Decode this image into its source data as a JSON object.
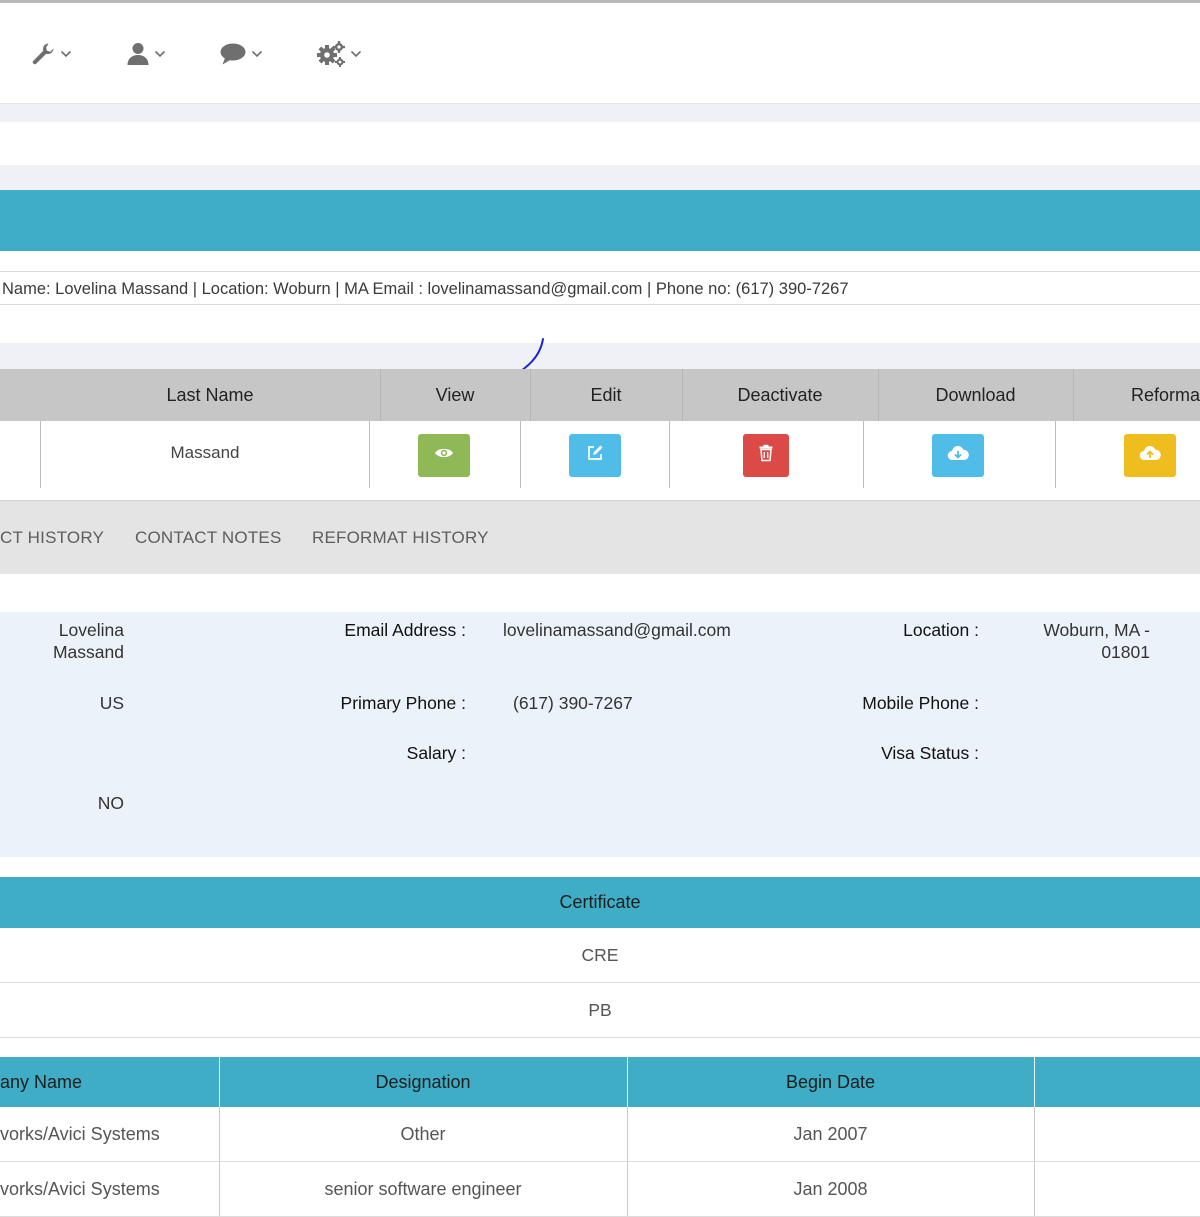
{
  "nav": {
    "items": [
      {
        "icon": "wrench-icon"
      },
      {
        "icon": "user-icon"
      },
      {
        "icon": "chat-bubble-icon"
      },
      {
        "icon": "gears-icon"
      }
    ]
  },
  "info_strip": "Name: Lovelina Massand | Location: Woburn | MA Email : lovelinamassand@gmail.com | Phone no: (617) 390-7267",
  "grid": {
    "headers": {
      "last_name": "Last Name",
      "view": "View",
      "edit": "Edit",
      "deactivate": "Deactivate",
      "download": "Download",
      "reformat": "Reforma"
    },
    "row": {
      "last_name": "Massand"
    },
    "colors": {
      "view": "#8fb857",
      "edit": "#4fbde8",
      "deactivate": "#db4a47",
      "download": "#4fbde8",
      "reformat": "#f0bd1e"
    }
  },
  "tabs": {
    "contact_history": "CT HISTORY",
    "contact_notes": "CONTACT NOTES",
    "reformat_history": "REFORMAT HISTORY"
  },
  "details": {
    "name_line1": "Lovelina",
    "name_line2": "Massand",
    "country": "US",
    "flag": "NO",
    "email_label": "Email Address :",
    "email_value": "lovelinamassand@gmail.com",
    "primary_phone_label": "Primary Phone :",
    "primary_phone_value": "(617) 390-7267",
    "salary_label": "Salary :",
    "location_label": "Location :",
    "location_line1": "Woburn, MA -",
    "location_line2": "01801",
    "mobile_phone_label": "Mobile Phone :",
    "visa_status_label": "Visa Status :"
  },
  "certificates": {
    "header": "Certificate",
    "rows": [
      "CRE",
      "PB"
    ]
  },
  "employment": {
    "headers": {
      "company": "any Name",
      "designation": "Designation",
      "begin_date": "Begin Date"
    },
    "rows": [
      {
        "company": "vorks/Avici Systems",
        "designation": "Other",
        "begin_date": "Jan 2007"
      },
      {
        "company": "vorks/Avici Systems",
        "designation": "senior software engineer",
        "begin_date": "Jan 2008"
      }
    ]
  }
}
